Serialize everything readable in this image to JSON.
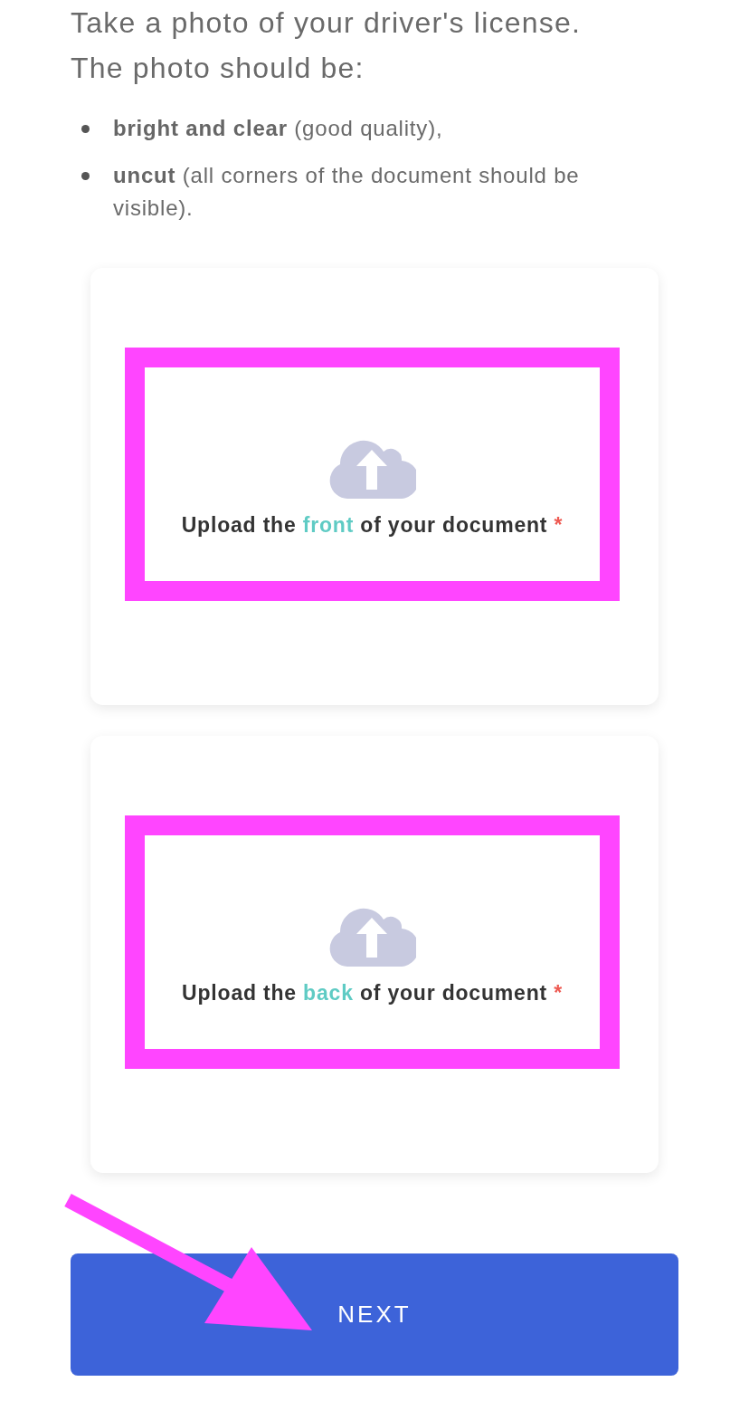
{
  "intro": {
    "lines": [
      "Take a photo of your driver's license.",
      "The photo should be:"
    ]
  },
  "requirements": [
    "**bright and clear** (good quality),",
    "**uncut** (all corners of the document should be visible)."
  ],
  "uploads": [
    {
      "prefix": "Upload the ",
      "side": "front",
      "suffix": " of your document",
      "required_mark": "*",
      "highlighted": true
    },
    {
      "prefix": "Upload the ",
      "side": "back",
      "suffix": " of your document",
      "required_mark": "*",
      "highlighted": true
    }
  ],
  "next_button": {
    "label": "NEXT",
    "arrow_pointer": true
  }
}
